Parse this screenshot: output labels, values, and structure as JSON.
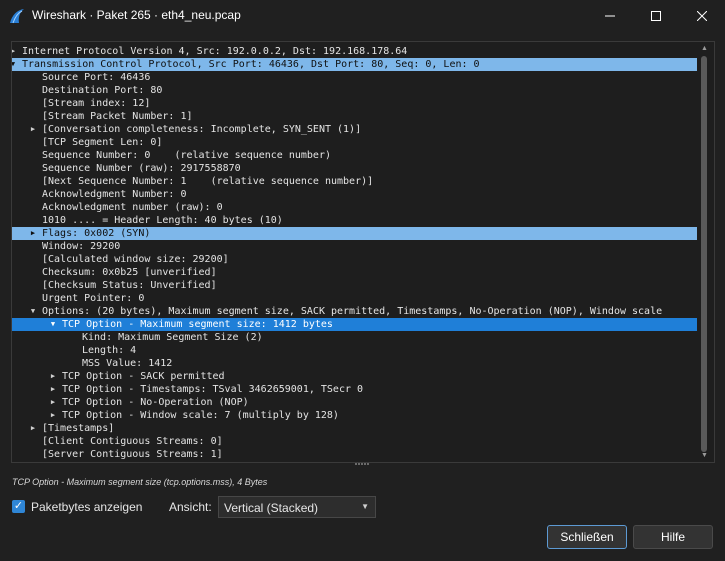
{
  "window": {
    "title": "Wireshark · Paket 265 · eth4_neu.pcap",
    "minimize_glyph": "—",
    "maximize_glyph": "☐",
    "close_glyph": "✕"
  },
  "tree": [
    {
      "text": "Internet Protocol Version 4, Src: 192.0.0.2, Dst: 192.168.178.64",
      "level": 0,
      "arrow": "▶",
      "hl": ""
    },
    {
      "text": "Transmission Control Protocol, Src Port: 46436, Dst Port: 80, Seq: 0, Len: 0",
      "level": 0,
      "arrow": "▼",
      "hl": "hl-light"
    },
    {
      "text": "Source Port: 46436",
      "level": 1,
      "arrow": "",
      "hl": ""
    },
    {
      "text": "Destination Port: 80",
      "level": 1,
      "arrow": "",
      "hl": ""
    },
    {
      "text": "[Stream index: 12]",
      "level": 1,
      "arrow": "",
      "hl": ""
    },
    {
      "text": "[Stream Packet Number: 1]",
      "level": 1,
      "arrow": "",
      "hl": ""
    },
    {
      "text": "[Conversation completeness: Incomplete, SYN_SENT (1)]",
      "level": 1,
      "arrow": "▶",
      "hl": ""
    },
    {
      "text": "[TCP Segment Len: 0]",
      "level": 1,
      "arrow": "",
      "hl": ""
    },
    {
      "text": "Sequence Number: 0    (relative sequence number)",
      "level": 1,
      "arrow": "",
      "hl": ""
    },
    {
      "text": "Sequence Number (raw): 2917558870",
      "level": 1,
      "arrow": "",
      "hl": ""
    },
    {
      "text": "[Next Sequence Number: 1    (relative sequence number)]",
      "level": 1,
      "arrow": "",
      "hl": ""
    },
    {
      "text": "Acknowledgment Number: 0",
      "level": 1,
      "arrow": "",
      "hl": ""
    },
    {
      "text": "Acknowledgment number (raw): 0",
      "level": 1,
      "arrow": "",
      "hl": ""
    },
    {
      "text": "1010 .... = Header Length: 40 bytes (10)",
      "level": 1,
      "arrow": "",
      "hl": ""
    },
    {
      "text": "Flags: 0x002 (SYN)",
      "level": 1,
      "arrow": "▶",
      "hl": "hl-light"
    },
    {
      "text": "Window: 29200",
      "level": 1,
      "arrow": "",
      "hl": ""
    },
    {
      "text": "[Calculated window size: 29200]",
      "level": 1,
      "arrow": "",
      "hl": ""
    },
    {
      "text": "Checksum: 0x0b25 [unverified]",
      "level": 1,
      "arrow": "",
      "hl": ""
    },
    {
      "text": "[Checksum Status: Unverified]",
      "level": 1,
      "arrow": "",
      "hl": ""
    },
    {
      "text": "Urgent Pointer: 0",
      "level": 1,
      "arrow": "",
      "hl": ""
    },
    {
      "text": "Options: (20 bytes), Maximum segment size, SACK permitted, Timestamps, No-Operation (NOP), Window scale",
      "level": 1,
      "arrow": "▼",
      "hl": ""
    },
    {
      "text": "TCP Option - Maximum segment size: 1412 bytes",
      "level": 2,
      "arrow": "▼",
      "hl": "hl-blue"
    },
    {
      "text": "Kind: Maximum Segment Size (2)",
      "level": 3,
      "arrow": "",
      "hl": ""
    },
    {
      "text": "Length: 4",
      "level": 3,
      "arrow": "",
      "hl": ""
    },
    {
      "text": "MSS Value: 1412",
      "level": 3,
      "arrow": "",
      "hl": ""
    },
    {
      "text": "TCP Option - SACK permitted",
      "level": 2,
      "arrow": "▶",
      "hl": ""
    },
    {
      "text": "TCP Option - Timestamps: TSval 3462659001, TSecr 0",
      "level": 2,
      "arrow": "▶",
      "hl": ""
    },
    {
      "text": "TCP Option - No-Operation (NOP)",
      "level": 2,
      "arrow": "▶",
      "hl": ""
    },
    {
      "text": "TCP Option - Window scale: 7 (multiply by 128)",
      "level": 2,
      "arrow": "▶",
      "hl": ""
    },
    {
      "text": "[Timestamps]",
      "level": 1,
      "arrow": "▶",
      "hl": ""
    },
    {
      "text": "[Client Contiguous Streams: 0]",
      "level": 1,
      "arrow": "",
      "hl": ""
    },
    {
      "text": "[Server Contiguous Streams: 1]",
      "level": 1,
      "arrow": "",
      "hl": ""
    }
  ],
  "status_text": "TCP Option - Maximum segment size (tcp.options.mss), 4 Bytes",
  "controls": {
    "show_bytes_label": "Paketbytes anzeigen",
    "show_bytes_checked": true,
    "view_label": "Ansicht:",
    "view_value": "Vertical (Stacked)"
  },
  "buttons": {
    "close_label": "Schließen",
    "help_label": "Hilfe"
  },
  "colors": {
    "selection": "#1f7fd8",
    "highlight": "#7eb7ea",
    "background": "#202020"
  }
}
